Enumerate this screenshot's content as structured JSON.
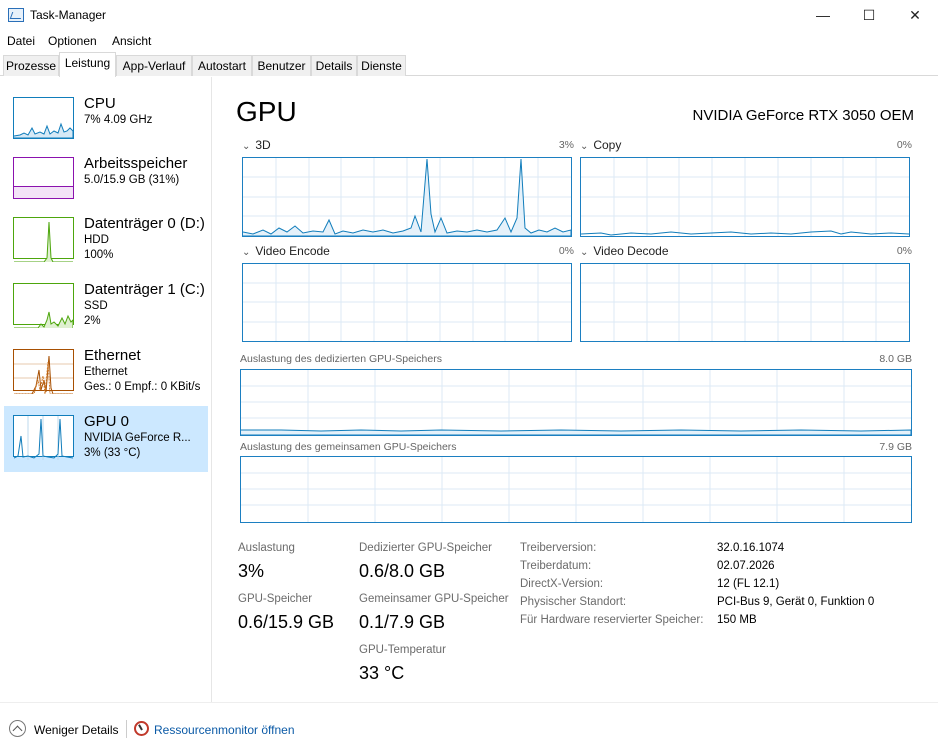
{
  "window": {
    "title": "Task-Manager",
    "minimize": "—",
    "maximize": "☐",
    "close": "✕"
  },
  "menu": [
    "Datei",
    "Optionen",
    "Ansicht"
  ],
  "tabs": [
    "Prozesse",
    "Leistung",
    "App-Verlauf",
    "Autostart",
    "Benutzer",
    "Details",
    "Dienste"
  ],
  "active_tab": "Leistung",
  "sidebar": [
    {
      "title": "CPU",
      "lines": [
        "7% 4.09 GHz"
      ],
      "color": "#117dbb",
      "selected": false
    },
    {
      "title": "Arbeitsspeicher",
      "lines": [
        "5.0/15.9 GB (31%)"
      ],
      "color": "#8b12ae",
      "selected": false
    },
    {
      "title": "Datenträger 0 (D:)",
      "lines": [
        "HDD",
        "100%"
      ],
      "color": "#4da60c",
      "selected": false
    },
    {
      "title": "Datenträger 1 (C:)",
      "lines": [
        "SSD",
        "2%"
      ],
      "color": "#4da60c",
      "selected": false
    },
    {
      "title": "Ethernet",
      "lines": [
        "Ethernet",
        "Ges.: 0 Empf.: 0 KBit/s"
      ],
      "color": "#a74f01",
      "selected": false
    },
    {
      "title": "GPU 0",
      "lines": [
        "NVIDIA GeForce R...",
        "3% (33 °C)"
      ],
      "color": "#117dbb",
      "selected": true
    }
  ],
  "main": {
    "title": "GPU",
    "gpu_name": "NVIDIA GeForce RTX 3050 OEM",
    "graphs": [
      {
        "label": "3D",
        "pct": "3%"
      },
      {
        "label": "Copy",
        "pct": "0%"
      },
      {
        "label": "Video Encode",
        "pct": "0%"
      },
      {
        "label": "Video Decode",
        "pct": "0%"
      }
    ],
    "dedicated_mem": {
      "label": "Auslastung des dedizierten GPU-Speichers",
      "max": "8.0 GB"
    },
    "shared_mem": {
      "label": "Auslastung des gemeinsamen GPU-Speichers",
      "max": "7.9 GB"
    },
    "stats": {
      "auslastung_label": "Auslastung",
      "auslastung_value": "3%",
      "gpu_mem_label": "GPU-Speicher",
      "gpu_mem_value": "0.6/15.9 GB",
      "dedicated_label": "Dedizierter GPU-Speicher",
      "dedicated_value": "0.6/8.0 GB",
      "shared_label": "Gemeinsamer GPU-Speicher",
      "shared_value": "0.1/7.9 GB",
      "temp_label": "GPU-Temperatur",
      "temp_value": "33 °C"
    },
    "info": [
      {
        "label": "Treiberversion:",
        "value": "32.0.16.1074"
      },
      {
        "label": "Treiberdatum:",
        "value": "02.07.2026"
      },
      {
        "label": "DirectX-Version:",
        "value": "12 (FL 12.1)"
      },
      {
        "label": "Physischer Standort:",
        "value": "PCI-Bus 9, Gerät 0, Funktion 0"
      },
      {
        "label": "Für Hardware reservierter Speicher:",
        "value": "150 MB"
      }
    ]
  },
  "footer": {
    "fewer_details": "Weniger Details",
    "resource_monitor": "Ressourcenmonitor öffnen"
  },
  "colors": {
    "graph_border": "#1c7fc1",
    "grid": "#d9eaf7",
    "selected_bg": "#cce8ff",
    "link": "#0b5aa6"
  }
}
